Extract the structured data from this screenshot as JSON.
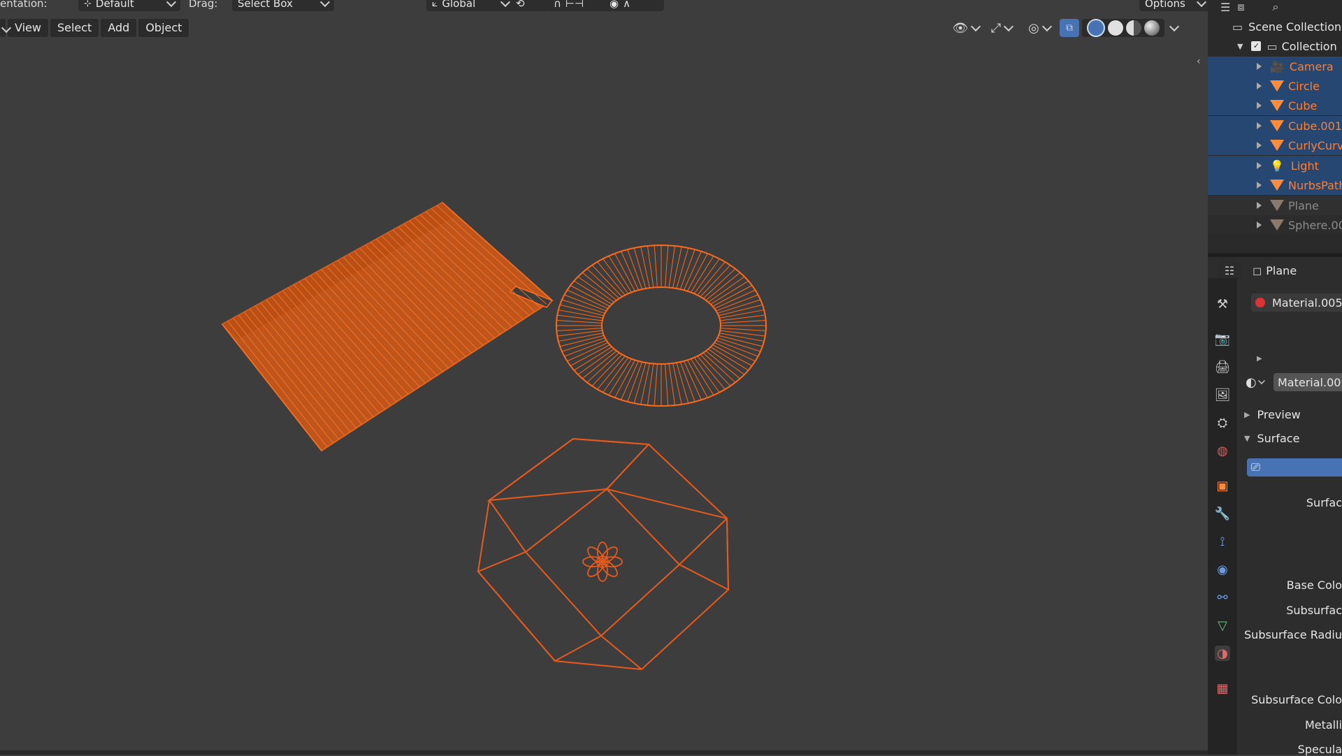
{
  "topbar": {
    "orientation_label": "entation:",
    "pivot_value": "Default",
    "drag_label": "Drag:",
    "drag_value": "Select Box",
    "transform_orientation": "Global",
    "options_label": "Options"
  },
  "menubar": {
    "items": [
      "View",
      "Select",
      "Add",
      "Object"
    ]
  },
  "outliner": {
    "scene_collection": "Scene Collection",
    "collection": "Collection",
    "items": [
      {
        "label": "Camera",
        "icon": "camera-icon",
        "selected": true
      },
      {
        "label": "Circle",
        "icon": "mesh-icon",
        "selected": true
      },
      {
        "label": "Cube",
        "icon": "mesh-icon",
        "selected": true
      },
      {
        "label": "Cube.001",
        "icon": "mesh-icon",
        "selected": true
      },
      {
        "label": "CurlyCurv",
        "icon": "mesh-icon",
        "selected": true
      },
      {
        "label": "Light",
        "icon": "light-icon",
        "selected": true
      },
      {
        "label": "NurbsPath",
        "icon": "mesh-icon",
        "selected": true
      },
      {
        "label": "Plane",
        "icon": "mesh-icon",
        "selected": false
      },
      {
        "label": "Sphere.00",
        "icon": "mesh-icon",
        "selected": false
      }
    ]
  },
  "properties": {
    "object_name": "Plane",
    "material_slot": "Material.005",
    "material_datablock": "Material.00",
    "panels": {
      "preview": "Preview",
      "surface": "Surface"
    },
    "labels": {
      "surface": "Surfac",
      "base_color": "Base Colo",
      "subsurface": "Subsurfac",
      "subsurface_radius": "Subsurface Radiu",
      "subsurface_color": "Subsurface Colo",
      "metallic": "Metalli",
      "specular": "Specula"
    }
  },
  "colors": {
    "selection_orange": "#ff6a1a",
    "wire_orange": "#e85a1c",
    "outliner_selected": "#264772",
    "accent_blue": "#4772b3"
  }
}
